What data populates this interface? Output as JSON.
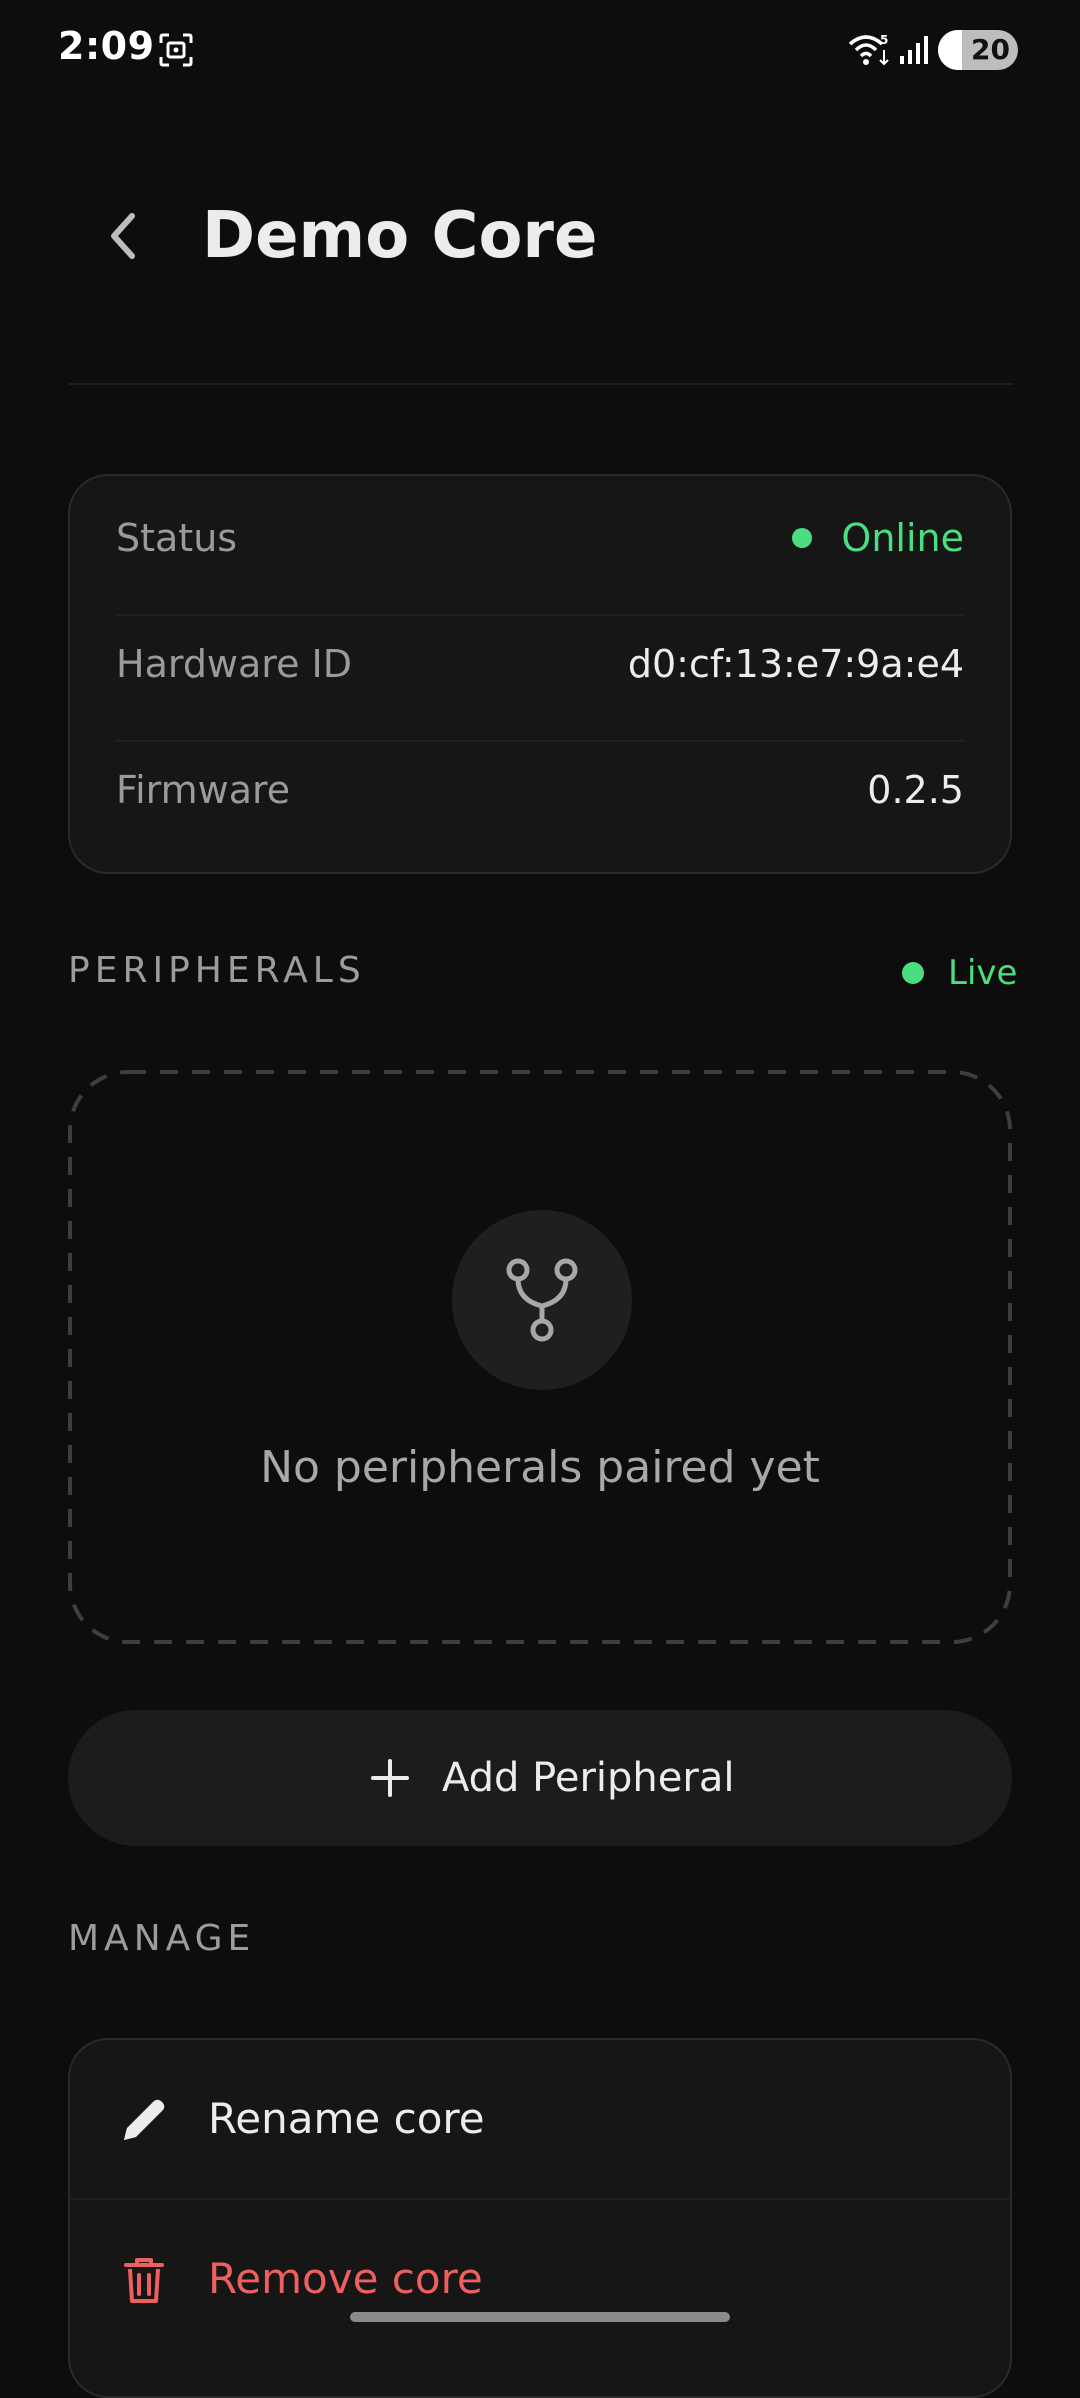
{
  "status_bar": {
    "time": "2:09",
    "battery_level": "20",
    "wifi_badge": "5"
  },
  "header": {
    "title": "Demo Core"
  },
  "info": {
    "rows": [
      {
        "label": "Status",
        "value": "Online"
      },
      {
        "label": "Hardware ID",
        "value": "d0:cf:13:e7:9a:e4"
      },
      {
        "label": "Firmware",
        "value": "0.2.5"
      }
    ],
    "online_color": "#4ade80"
  },
  "peripherals": {
    "heading": "PERIPHERALS",
    "live_label": "Live",
    "empty_text": "No peripherals paired yet",
    "icon": "fork-icon"
  },
  "add_button": {
    "label": "Add Peripheral",
    "icon": "plus-icon"
  },
  "manage": {
    "heading": "MANAGE",
    "items": [
      {
        "label": "Rename core",
        "icon": "pencil-icon"
      },
      {
        "label": "Remove core",
        "icon": "trash-icon",
        "color": "#ef5f5f"
      }
    ]
  }
}
